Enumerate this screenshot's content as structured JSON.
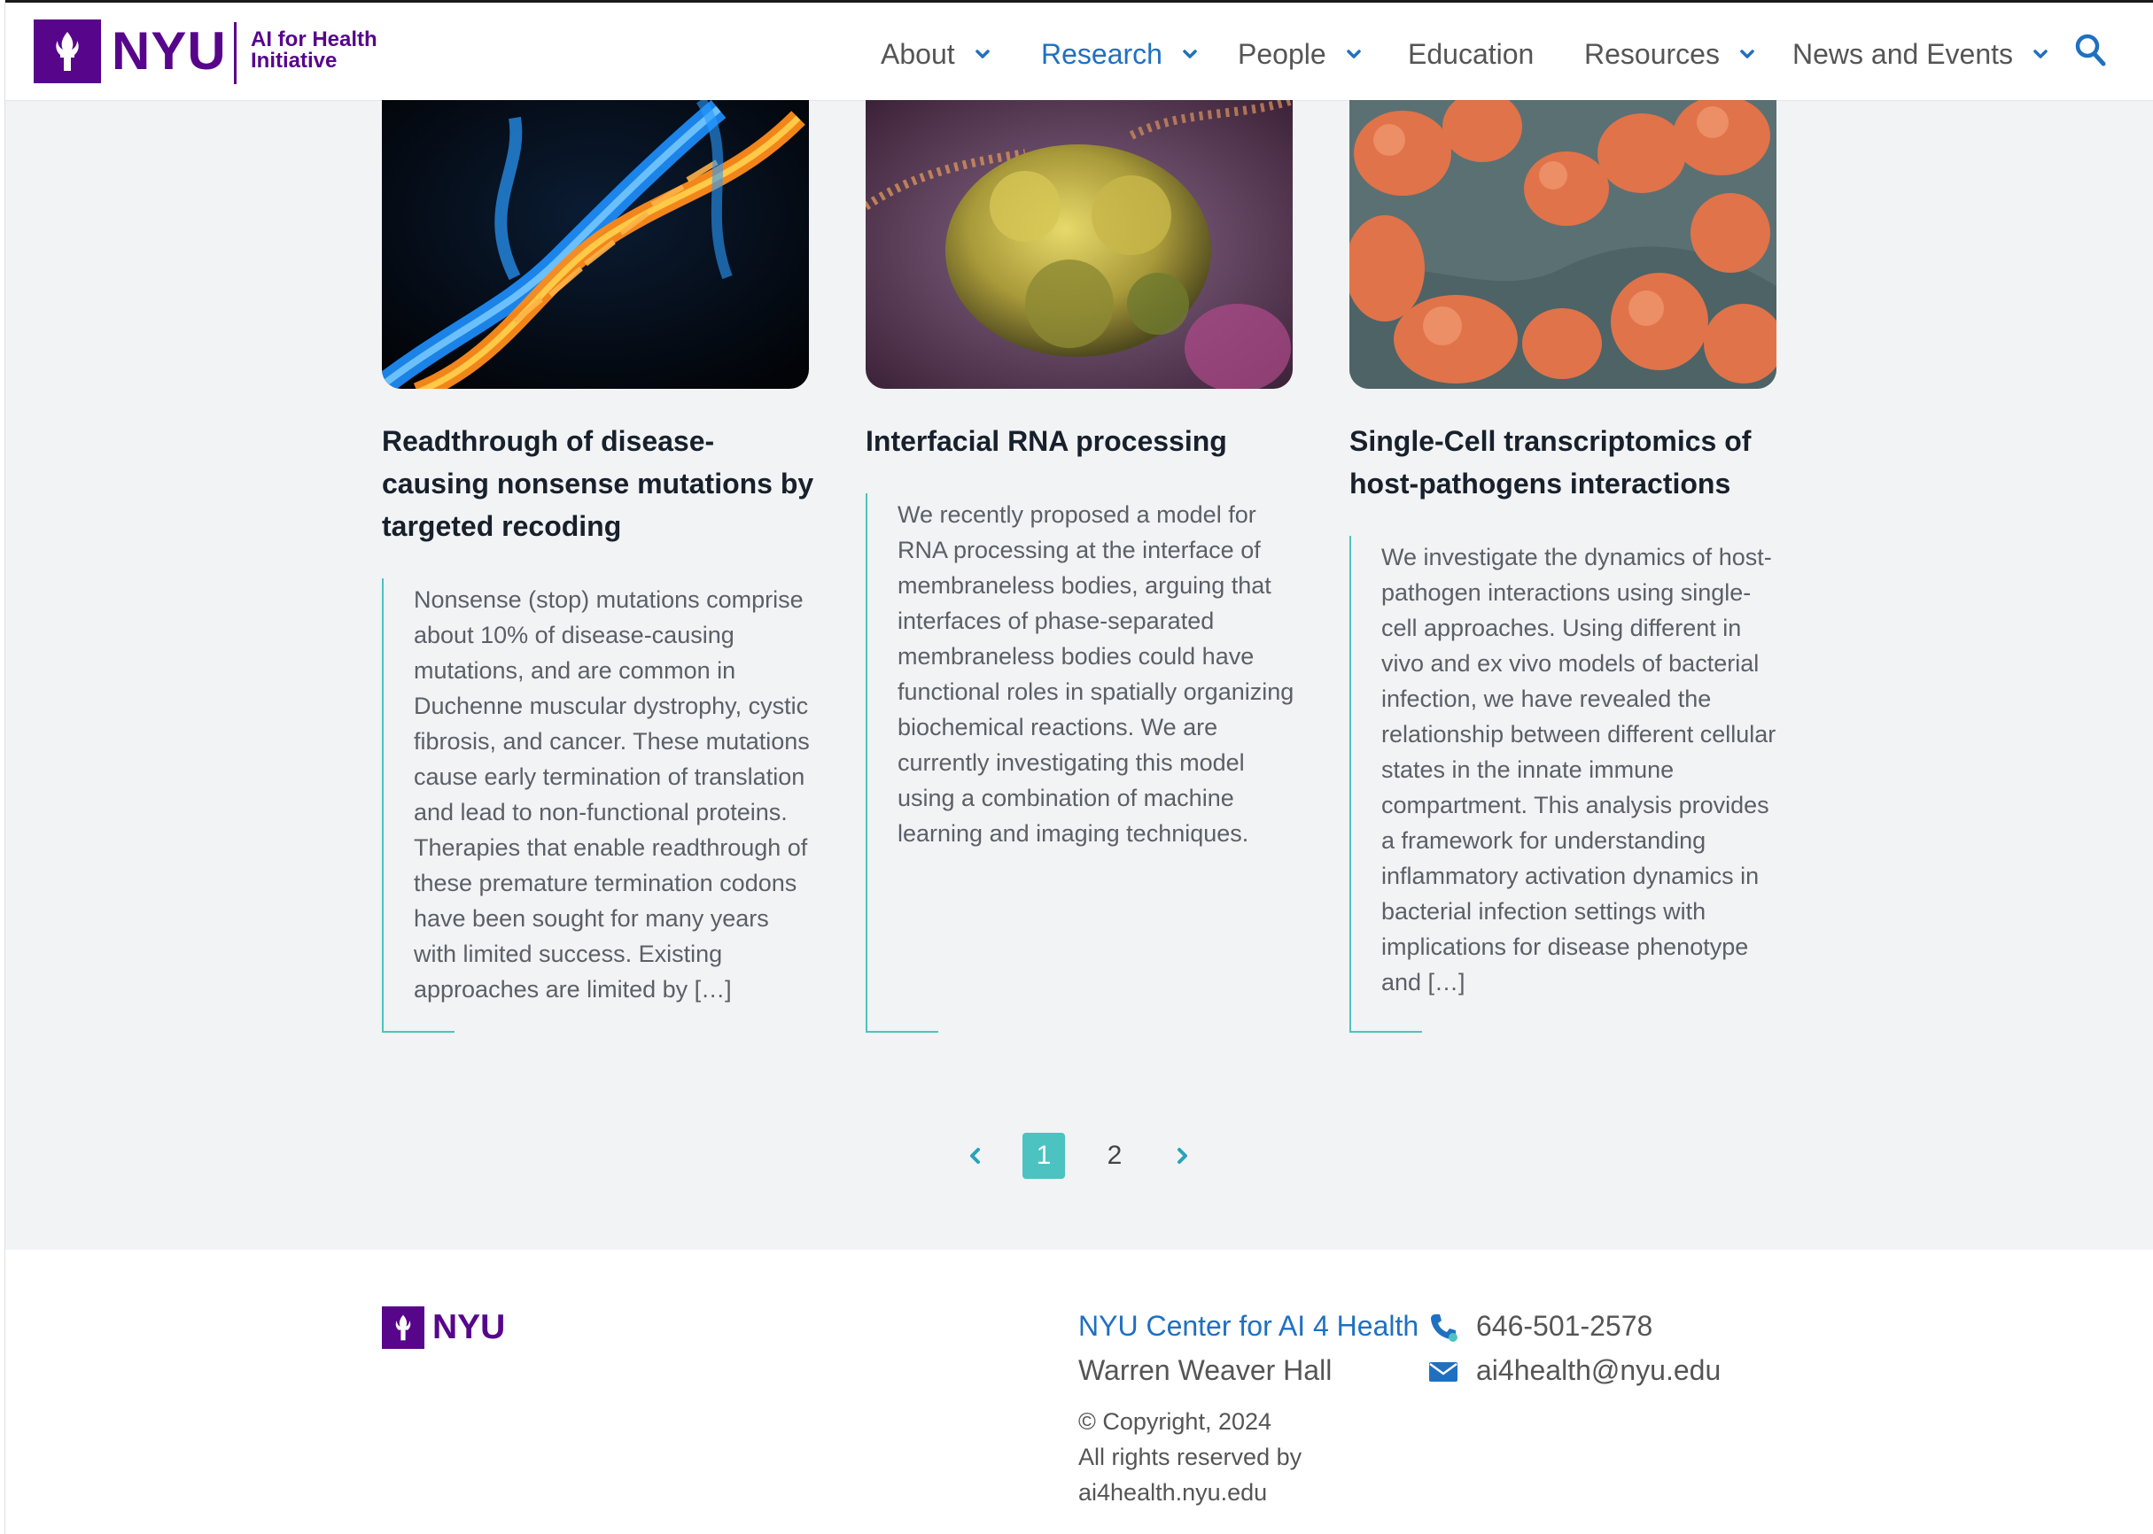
{
  "header": {
    "logo_word": "NYU",
    "logo_sub_line1": "AI for Health",
    "logo_sub_line2": "Initiative",
    "nav": [
      {
        "label": "About",
        "has_dropdown": true,
        "active": false
      },
      {
        "label": "Research",
        "has_dropdown": true,
        "active": true
      },
      {
        "label": "People",
        "has_dropdown": true,
        "active": false
      },
      {
        "label": "Education",
        "has_dropdown": false,
        "active": false
      },
      {
        "label": "Resources",
        "has_dropdown": true,
        "active": false
      },
      {
        "label": "News and Events",
        "has_dropdown": true,
        "active": false
      }
    ],
    "search_icon": "search-icon"
  },
  "cards": [
    {
      "image": "dna-double-helix-image",
      "title": "Readthrough of disease-causing nonsense mutations by targeted recoding",
      "body": "Nonsense (stop) mutations comprise about 10% of disease-causing mutations, and are common in Duchenne muscular dystrophy, cystic fibrosis, and cancer. These mutations cause early termination of translation and lead to non-functional proteins. Therapies that enable readthrough of these premature termination codons have been sought for many years with limited success. Existing approaches are limited by […]"
    },
    {
      "image": "rna-protein-complex-image",
      "title": "Interfacial RNA processing",
      "body": "We recently proposed a model for RNA processing at the interface of membraneless bodies, arguing that interfaces of phase-separated membraneless bodies could have functional roles in spatially organizing biochemical reactions. We are currently investigating this model using a combination of machine learning and imaging techniques."
    },
    {
      "image": "bacteria-micrograph-image",
      "title": "Single-Cell transcriptomics of host-pathogens interactions",
      "body": "We investigate the dynamics of host-pathogen interactions using single-cell approaches. Using different in vivo and ex vivo models of bacterial infection, we have revealed the relationship between different cellular states in the innate immune compartment. This analysis provides a framework for understanding inflammatory activation dynamics in bacterial infection settings with implications for disease phenotype and […]"
    }
  ],
  "pagination": {
    "current": "1",
    "next_page": "2",
    "prev_icon": "chevron-left-icon",
    "next_icon": "chevron-right-icon"
  },
  "footer": {
    "logo_word": "NYU",
    "center_name": "NYU Center for AI 4 Health",
    "building": "Warren Weaver Hall",
    "copyright_line1": "© Copyright, 2024",
    "copyright_line2": "All rights reserved by",
    "copyright_line3": "ai4health.nyu.edu",
    "phone": "646-501-2578",
    "email": "ai4health@nyu.edu",
    "phone_icon": "phone-icon",
    "email_icon": "envelope-icon"
  },
  "colors": {
    "brand_purple": "#57068c",
    "link_blue": "#1f70c1",
    "accent_teal": "#4cc3c0",
    "page_background": "#f1f3f5"
  }
}
